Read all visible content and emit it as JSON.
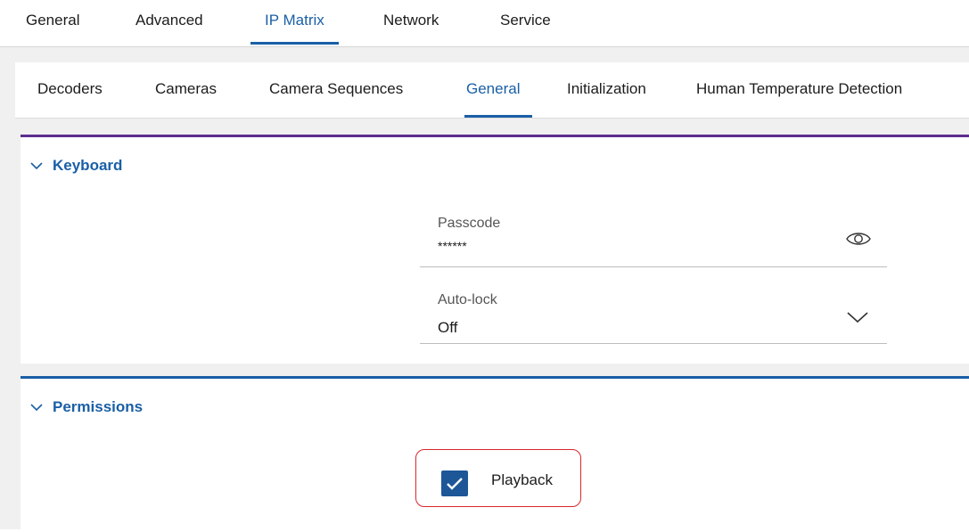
{
  "top_tabs": [
    {
      "label": "General"
    },
    {
      "label": "Advanced"
    },
    {
      "label": "IP Matrix",
      "active": true
    },
    {
      "label": "Network"
    },
    {
      "label": "Service"
    }
  ],
  "sub_tabs": [
    {
      "label": "Decoders"
    },
    {
      "label": "Cameras"
    },
    {
      "label": "Camera Sequences"
    },
    {
      "label": "General",
      "active": true
    },
    {
      "label": "Initialization"
    },
    {
      "label": "Human Temperature Detection"
    }
  ],
  "keyboard": {
    "title": "Keyboard",
    "passcode": {
      "label": "Passcode",
      "value": "******",
      "icon": "eye-icon"
    },
    "autolock": {
      "label": "Auto-lock",
      "value": "Off",
      "icon": "chevron-down-icon"
    }
  },
  "permissions": {
    "title": "Permissions",
    "playback": {
      "label": "Playback",
      "checked": true
    }
  },
  "colors": {
    "accent": "#1a5fa6",
    "keyboard_bar": "#5c2d8f",
    "permissions_bar": "#1a5fa6",
    "checkbox": "#1d5798",
    "highlight_border": "#d9262c"
  }
}
